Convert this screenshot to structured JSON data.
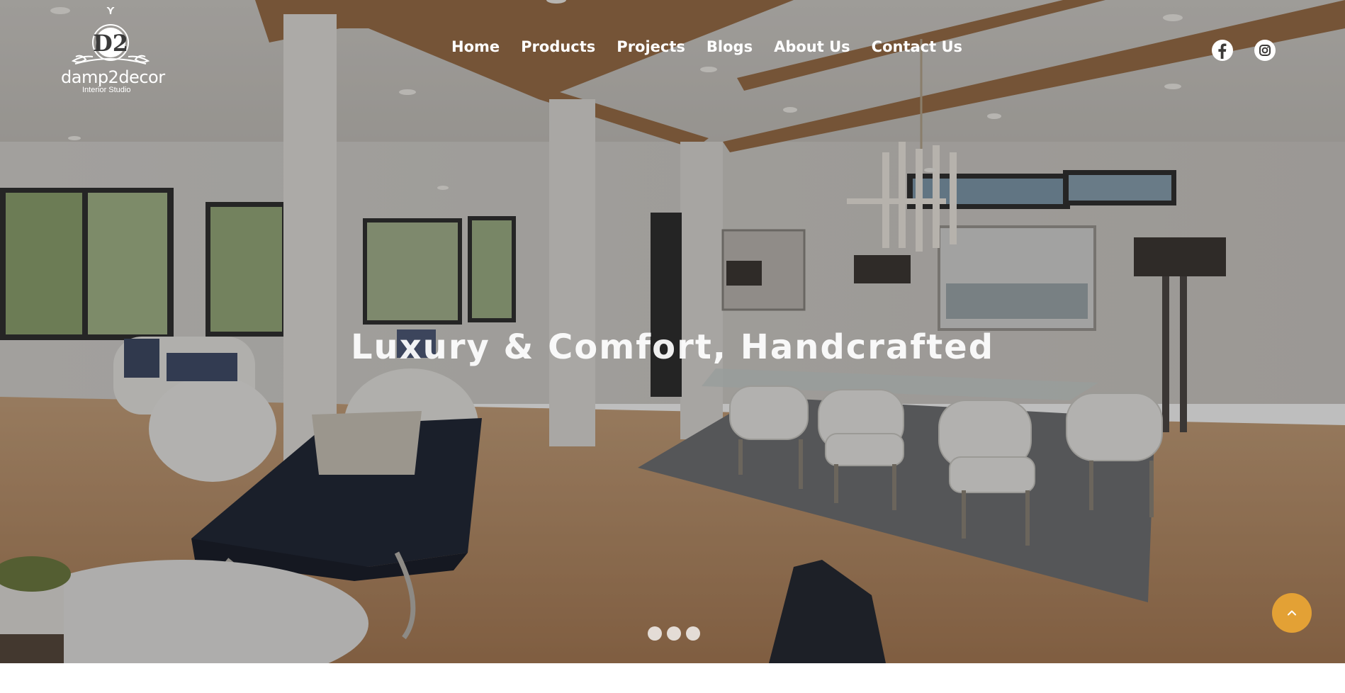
{
  "brand": {
    "name": "damp2decor",
    "tagline": "Interior Studio",
    "monogram": "D2"
  },
  "nav": {
    "items": [
      {
        "label": "Home"
      },
      {
        "label": "Products"
      },
      {
        "label": "Projects"
      },
      {
        "label": "Blogs"
      },
      {
        "label": "About Us"
      },
      {
        "label": "Contact Us"
      }
    ]
  },
  "social": [
    {
      "icon": "facebook-icon"
    },
    {
      "icon": "instagram-icon"
    }
  ],
  "hero": {
    "title": "Luxury & Comfort, Handcrafted",
    "slide_count": 3
  },
  "scroll_top": {
    "icon": "chevron-up-icon",
    "color": "#e3a135"
  },
  "colors": {
    "accent": "#e3a135",
    "text": "#ffffff"
  }
}
